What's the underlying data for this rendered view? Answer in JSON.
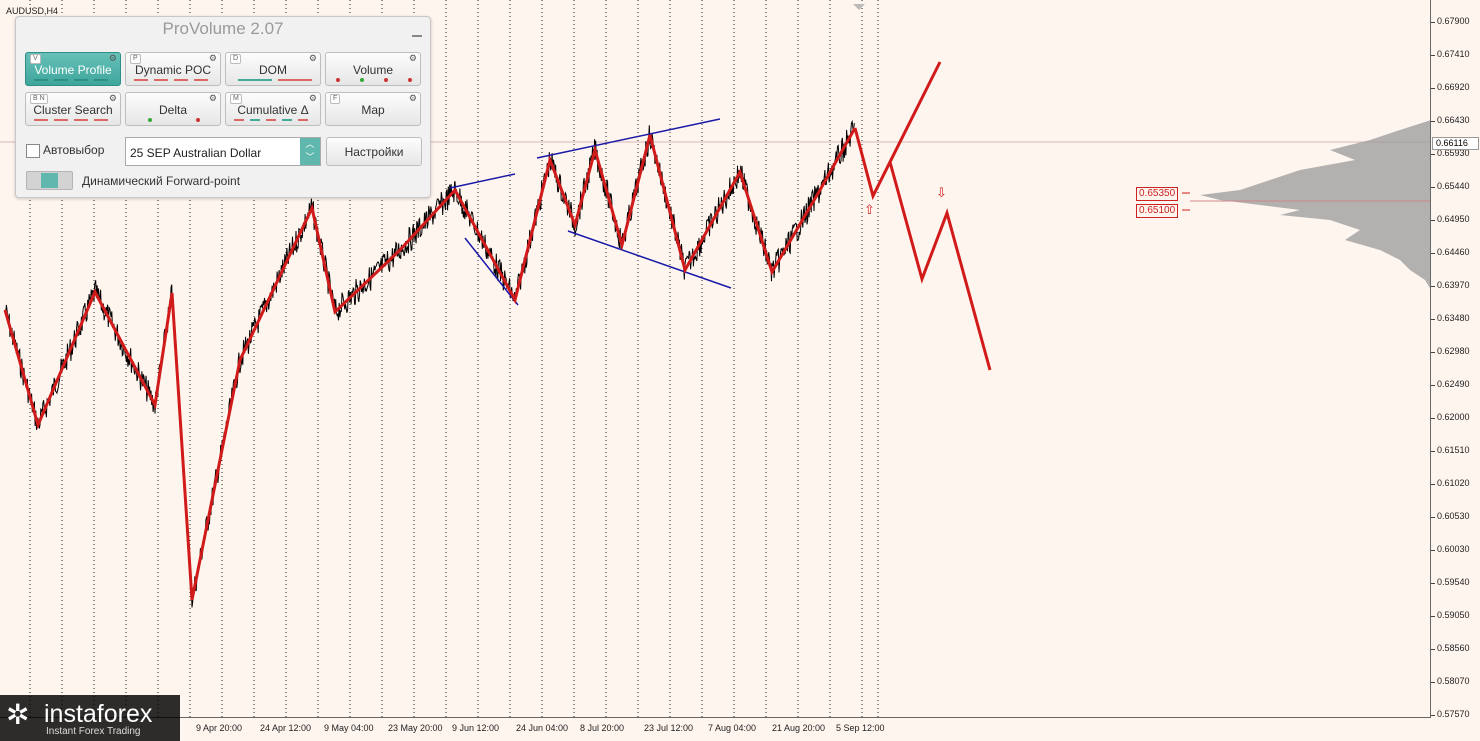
{
  "chart": {
    "symbol": "AUDUSD,H4",
    "current_price": "0.66116",
    "price_labels": [
      "0.67900",
      "0.67410",
      "0.66920",
      "0.66430",
      "0.65930",
      "0.65440",
      "0.64950",
      "0.64460",
      "0.63970",
      "0.63480",
      "0.62980",
      "0.62490",
      "0.62000",
      "0.61510",
      "0.61020",
      "0.60530",
      "0.60030",
      "0.59540",
      "0.59050",
      "0.58560",
      "0.58070",
      "0.57570"
    ],
    "time_labels": [
      "9 Apr 20:00",
      "24 Apr 12:00",
      "9 May 04:00",
      "23 May 20:00",
      "9 Jun 12:00",
      "24 Jun 04:00",
      "8 Jul 20:00",
      "23 Jul 12:00",
      "7 Aug 04:00",
      "21 Aug 20:00",
      "5 Sep 12:00"
    ],
    "level_1": "0.65350",
    "level_2": "0.65100",
    "colors": {
      "zigzag": "#d11a1a",
      "channel": "#1a1aa8",
      "price": "#000000",
      "profile": "#9a9a9a",
      "background": "#fff5ef"
    }
  },
  "panel": {
    "title": "ProVolume 2.07",
    "buttons": [
      {
        "label": "Volume Profile",
        "hotkey": "V",
        "active": true
      },
      {
        "label": "Dynamic POC",
        "hotkey": "P",
        "active": false
      },
      {
        "label": "DOM",
        "hotkey": "D",
        "active": false
      },
      {
        "label": "Volume",
        "hotkey": "",
        "active": false
      },
      {
        "label": "Cluster Search",
        "hotkey": "B N",
        "active": false
      },
      {
        "label": "Delta",
        "hotkey": "",
        "active": false
      },
      {
        "label": "Cumulative Δ",
        "hotkey": "M",
        "active": false
      },
      {
        "label": "Map",
        "hotkey": "F",
        "active": false
      }
    ],
    "auto_select_label": "Автовыбор",
    "instrument": "25 SEP Australian Dollar",
    "settings_label": "Настройки",
    "forward_label": "Динамический Forward-point"
  },
  "logo": {
    "name": "instaforex",
    "tagline": "Instant Forex Trading"
  }
}
